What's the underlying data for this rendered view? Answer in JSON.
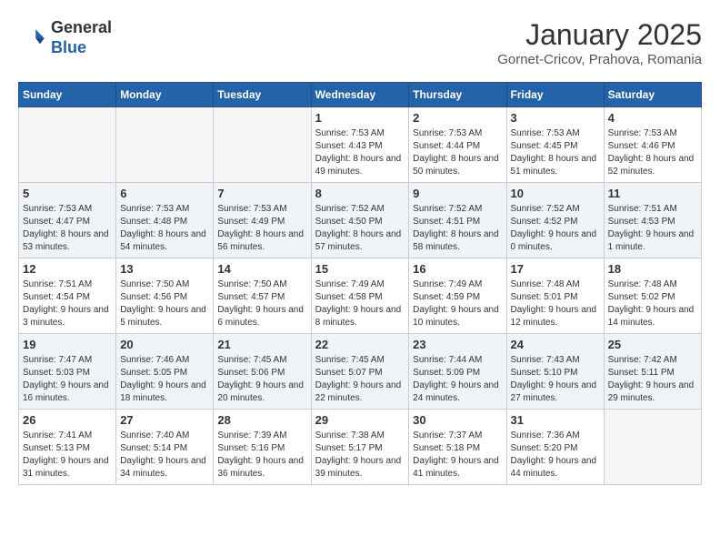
{
  "header": {
    "logo_line1": "General",
    "logo_line2": "Blue",
    "month": "January 2025",
    "location": "Gornet-Cricov, Prahova, Romania"
  },
  "weekdays": [
    "Sunday",
    "Monday",
    "Tuesday",
    "Wednesday",
    "Thursday",
    "Friday",
    "Saturday"
  ],
  "weeks": [
    [
      {
        "day": "",
        "sunrise": "",
        "sunset": "",
        "daylight": "",
        "empty": true
      },
      {
        "day": "",
        "sunrise": "",
        "sunset": "",
        "daylight": "",
        "empty": true
      },
      {
        "day": "",
        "sunrise": "",
        "sunset": "",
        "daylight": "",
        "empty": true
      },
      {
        "day": "1",
        "sunrise": "Sunrise: 7:53 AM",
        "sunset": "Sunset: 4:43 PM",
        "daylight": "Daylight: 8 hours and 49 minutes."
      },
      {
        "day": "2",
        "sunrise": "Sunrise: 7:53 AM",
        "sunset": "Sunset: 4:44 PM",
        "daylight": "Daylight: 8 hours and 50 minutes."
      },
      {
        "day": "3",
        "sunrise": "Sunrise: 7:53 AM",
        "sunset": "Sunset: 4:45 PM",
        "daylight": "Daylight: 8 hours and 51 minutes."
      },
      {
        "day": "4",
        "sunrise": "Sunrise: 7:53 AM",
        "sunset": "Sunset: 4:46 PM",
        "daylight": "Daylight: 8 hours and 52 minutes."
      }
    ],
    [
      {
        "day": "5",
        "sunrise": "Sunrise: 7:53 AM",
        "sunset": "Sunset: 4:47 PM",
        "daylight": "Daylight: 8 hours and 53 minutes."
      },
      {
        "day": "6",
        "sunrise": "Sunrise: 7:53 AM",
        "sunset": "Sunset: 4:48 PM",
        "daylight": "Daylight: 8 hours and 54 minutes."
      },
      {
        "day": "7",
        "sunrise": "Sunrise: 7:53 AM",
        "sunset": "Sunset: 4:49 PM",
        "daylight": "Daylight: 8 hours and 56 minutes."
      },
      {
        "day": "8",
        "sunrise": "Sunrise: 7:52 AM",
        "sunset": "Sunset: 4:50 PM",
        "daylight": "Daylight: 8 hours and 57 minutes."
      },
      {
        "day": "9",
        "sunrise": "Sunrise: 7:52 AM",
        "sunset": "Sunset: 4:51 PM",
        "daylight": "Daylight: 8 hours and 58 minutes."
      },
      {
        "day": "10",
        "sunrise": "Sunrise: 7:52 AM",
        "sunset": "Sunset: 4:52 PM",
        "daylight": "Daylight: 9 hours and 0 minutes."
      },
      {
        "day": "11",
        "sunrise": "Sunrise: 7:51 AM",
        "sunset": "Sunset: 4:53 PM",
        "daylight": "Daylight: 9 hours and 1 minute."
      }
    ],
    [
      {
        "day": "12",
        "sunrise": "Sunrise: 7:51 AM",
        "sunset": "Sunset: 4:54 PM",
        "daylight": "Daylight: 9 hours and 3 minutes."
      },
      {
        "day": "13",
        "sunrise": "Sunrise: 7:50 AM",
        "sunset": "Sunset: 4:56 PM",
        "daylight": "Daylight: 9 hours and 5 minutes."
      },
      {
        "day": "14",
        "sunrise": "Sunrise: 7:50 AM",
        "sunset": "Sunset: 4:57 PM",
        "daylight": "Daylight: 9 hours and 6 minutes."
      },
      {
        "day": "15",
        "sunrise": "Sunrise: 7:49 AM",
        "sunset": "Sunset: 4:58 PM",
        "daylight": "Daylight: 9 hours and 8 minutes."
      },
      {
        "day": "16",
        "sunrise": "Sunrise: 7:49 AM",
        "sunset": "Sunset: 4:59 PM",
        "daylight": "Daylight: 9 hours and 10 minutes."
      },
      {
        "day": "17",
        "sunrise": "Sunrise: 7:48 AM",
        "sunset": "Sunset: 5:01 PM",
        "daylight": "Daylight: 9 hours and 12 minutes."
      },
      {
        "day": "18",
        "sunrise": "Sunrise: 7:48 AM",
        "sunset": "Sunset: 5:02 PM",
        "daylight": "Daylight: 9 hours and 14 minutes."
      }
    ],
    [
      {
        "day": "19",
        "sunrise": "Sunrise: 7:47 AM",
        "sunset": "Sunset: 5:03 PM",
        "daylight": "Daylight: 9 hours and 16 minutes."
      },
      {
        "day": "20",
        "sunrise": "Sunrise: 7:46 AM",
        "sunset": "Sunset: 5:05 PM",
        "daylight": "Daylight: 9 hours and 18 minutes."
      },
      {
        "day": "21",
        "sunrise": "Sunrise: 7:45 AM",
        "sunset": "Sunset: 5:06 PM",
        "daylight": "Daylight: 9 hours and 20 minutes."
      },
      {
        "day": "22",
        "sunrise": "Sunrise: 7:45 AM",
        "sunset": "Sunset: 5:07 PM",
        "daylight": "Daylight: 9 hours and 22 minutes."
      },
      {
        "day": "23",
        "sunrise": "Sunrise: 7:44 AM",
        "sunset": "Sunset: 5:09 PM",
        "daylight": "Daylight: 9 hours and 24 minutes."
      },
      {
        "day": "24",
        "sunrise": "Sunrise: 7:43 AM",
        "sunset": "Sunset: 5:10 PM",
        "daylight": "Daylight: 9 hours and 27 minutes."
      },
      {
        "day": "25",
        "sunrise": "Sunrise: 7:42 AM",
        "sunset": "Sunset: 5:11 PM",
        "daylight": "Daylight: 9 hours and 29 minutes."
      }
    ],
    [
      {
        "day": "26",
        "sunrise": "Sunrise: 7:41 AM",
        "sunset": "Sunset: 5:13 PM",
        "daylight": "Daylight: 9 hours and 31 minutes."
      },
      {
        "day": "27",
        "sunrise": "Sunrise: 7:40 AM",
        "sunset": "Sunset: 5:14 PM",
        "daylight": "Daylight: 9 hours and 34 minutes."
      },
      {
        "day": "28",
        "sunrise": "Sunrise: 7:39 AM",
        "sunset": "Sunset: 5:16 PM",
        "daylight": "Daylight: 9 hours and 36 minutes."
      },
      {
        "day": "29",
        "sunrise": "Sunrise: 7:38 AM",
        "sunset": "Sunset: 5:17 PM",
        "daylight": "Daylight: 9 hours and 39 minutes."
      },
      {
        "day": "30",
        "sunrise": "Sunrise: 7:37 AM",
        "sunset": "Sunset: 5:18 PM",
        "daylight": "Daylight: 9 hours and 41 minutes."
      },
      {
        "day": "31",
        "sunrise": "Sunrise: 7:36 AM",
        "sunset": "Sunset: 5:20 PM",
        "daylight": "Daylight: 9 hours and 44 minutes."
      },
      {
        "day": "",
        "sunrise": "",
        "sunset": "",
        "daylight": "",
        "empty": true
      }
    ]
  ]
}
